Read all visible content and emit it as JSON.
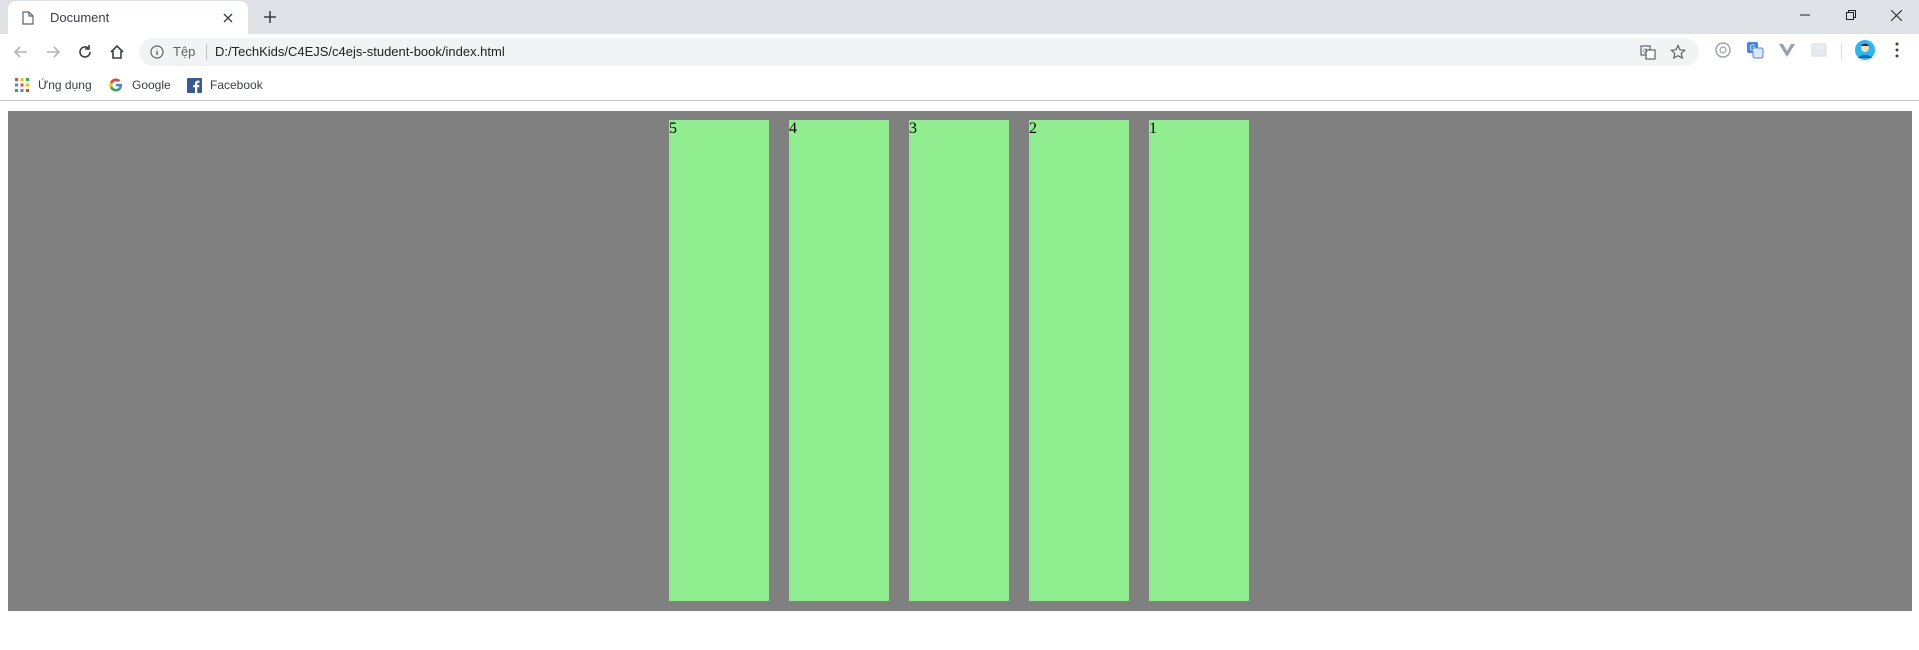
{
  "browser": {
    "tab": {
      "title": "Document",
      "favicon": "page-icon"
    },
    "address": {
      "scheme_label": "Tệp",
      "url": "D:/TechKids/C4EJS/c4ejs-student-book/index.html"
    },
    "bookmarks": [
      {
        "label": "Ứng dụng",
        "icon": "apps-grid-icon"
      },
      {
        "label": "Google",
        "icon": "google-icon"
      },
      {
        "label": "Facebook",
        "icon": "facebook-icon"
      }
    ],
    "accent_colors": {
      "tabstrip": "#dee1e6",
      "page_bg": "#808080",
      "bar": "#90ee90",
      "facebook": "#3b5998"
    }
  },
  "page": {
    "boxes": [
      {
        "label": "5"
      },
      {
        "label": "4"
      },
      {
        "label": "3"
      },
      {
        "label": "2"
      },
      {
        "label": "1"
      }
    ]
  }
}
